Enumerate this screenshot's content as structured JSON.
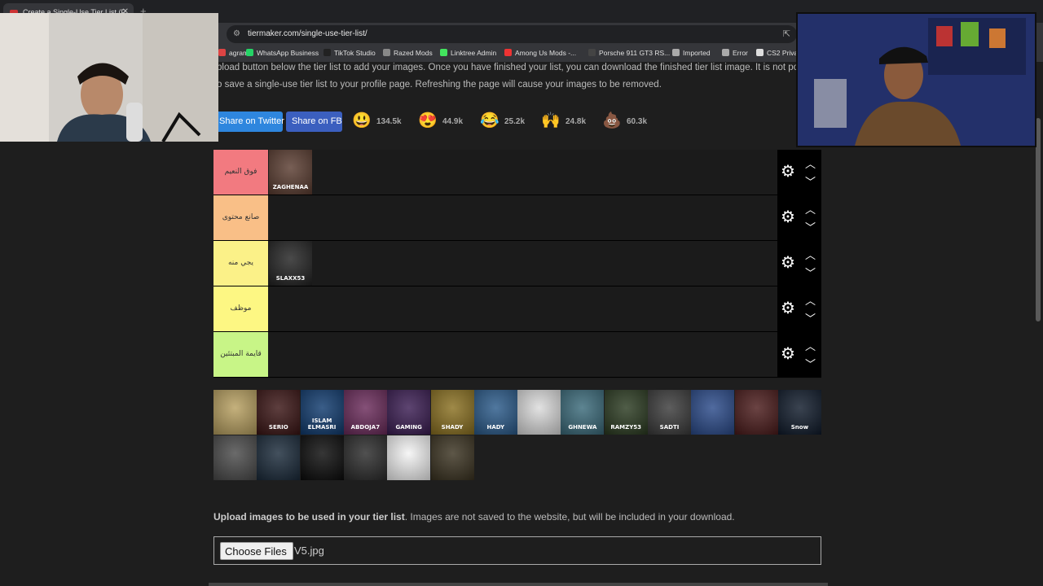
{
  "browser": {
    "tab_title": "Create a Single-Use Tier List (P...",
    "url": "tiermaker.com/single-use-tier-list/"
  },
  "bookmarks": [
    {
      "label": "agram",
      "color": "#d44"
    },
    {
      "label": "WhatsApp Business",
      "color": "#25d366"
    },
    {
      "label": "TikTok Studio",
      "color": "#222"
    },
    {
      "label": "Razed Mods",
      "color": "#888"
    },
    {
      "label": "Linktree Admin",
      "color": "#43e55e"
    },
    {
      "label": "Among Us Mods -...",
      "color": "#e33"
    },
    {
      "label": "Porsche 911 GT3 RS...",
      "color": "#444"
    },
    {
      "label": "Imported",
      "color": "#aaa"
    },
    {
      "label": "Error",
      "color": "#aaa"
    },
    {
      "label": "CS2 Privat",
      "color": "#ddd"
    }
  ],
  "intro": {
    "line1": "pload button below the tier list to add your images. Once you have finished your list, you can download the finished tier list image. It is not pos",
    "line2": "o save a single-use tier list to your profile page. Refreshing the page will cause your images to be removed."
  },
  "share": {
    "twitter": "Share on Twitter",
    "facebook": "Share on FB"
  },
  "reactions": [
    {
      "icon": "neutral-face",
      "glyph": "😃",
      "count": "134.5k"
    },
    {
      "icon": "heart-eyes",
      "glyph": "😍",
      "count": "44.9k"
    },
    {
      "icon": "laughing",
      "glyph": "😂",
      "count": "25.2k"
    },
    {
      "icon": "raised-hands",
      "glyph": "🙌",
      "count": "24.8k"
    },
    {
      "icon": "poop",
      "glyph": "💩",
      "count": "60.3k"
    }
  ],
  "tiers": [
    {
      "label": "فوق النعيم",
      "color": "#f27a80",
      "items": [
        {
          "name": "ZAGHENAA",
          "bg": "#5a3c30"
        }
      ]
    },
    {
      "label": "صانع محتوى",
      "color": "#f9bf87",
      "items": []
    },
    {
      "label": "يجي منه",
      "color": "#fbf188",
      "items": [
        {
          "name": "SLAXX53",
          "bg": "#222"
        }
      ]
    },
    {
      "label": "موظف",
      "color": "#fdf783",
      "items": []
    },
    {
      "label": "قايمة المبتئين",
      "color": "#c8f587",
      "items": []
    }
  ],
  "pool": [
    {
      "name": "",
      "bg": "#b8a060"
    },
    {
      "name": "SERIO",
      "bg": "#3a1414"
    },
    {
      "name": "ISLAM ELMASRI",
      "bg": "#0f3a6e"
    },
    {
      "name": "ABDOJA7",
      "bg": "#6a2a5a"
    },
    {
      "name": "GAMING",
      "bg": "#3a1c52"
    },
    {
      "name": "SHADY",
      "bg": "#8a7020"
    },
    {
      "name": "HADY",
      "bg": "#2a5a8a"
    },
    {
      "name": "",
      "bg": "#dcdcdc"
    },
    {
      "name": "GHNEWA",
      "bg": "#3a6a7a"
    },
    {
      "name": "RAMZY53",
      "bg": "#2a3a20"
    },
    {
      "name": "SADTI",
      "bg": "#3a3a3a"
    },
    {
      "name": "",
      "bg": "#2a4a8a"
    },
    {
      "name": "",
      "bg": "#4a1a1a"
    },
    {
      "name": "Snow",
      "bg": "#0f1a2a"
    },
    {
      "name": "",
      "bg": "#4a4a4a"
    },
    {
      "name": "",
      "bg": "#1a2a3a"
    },
    {
      "name": "",
      "bg": "#0a0a0a"
    },
    {
      "name": "",
      "bg": "#2a2a2a"
    },
    {
      "name": "",
      "bg": "#f4f4f4"
    },
    {
      "name": "",
      "bg": "#3a3220"
    }
  ],
  "upload": {
    "bold": "Upload images to be used in your tier list",
    "rest": ". Images are not saved to the website, but will be included in your download.",
    "button": "Choose Files",
    "filename": "V5.jpg"
  }
}
